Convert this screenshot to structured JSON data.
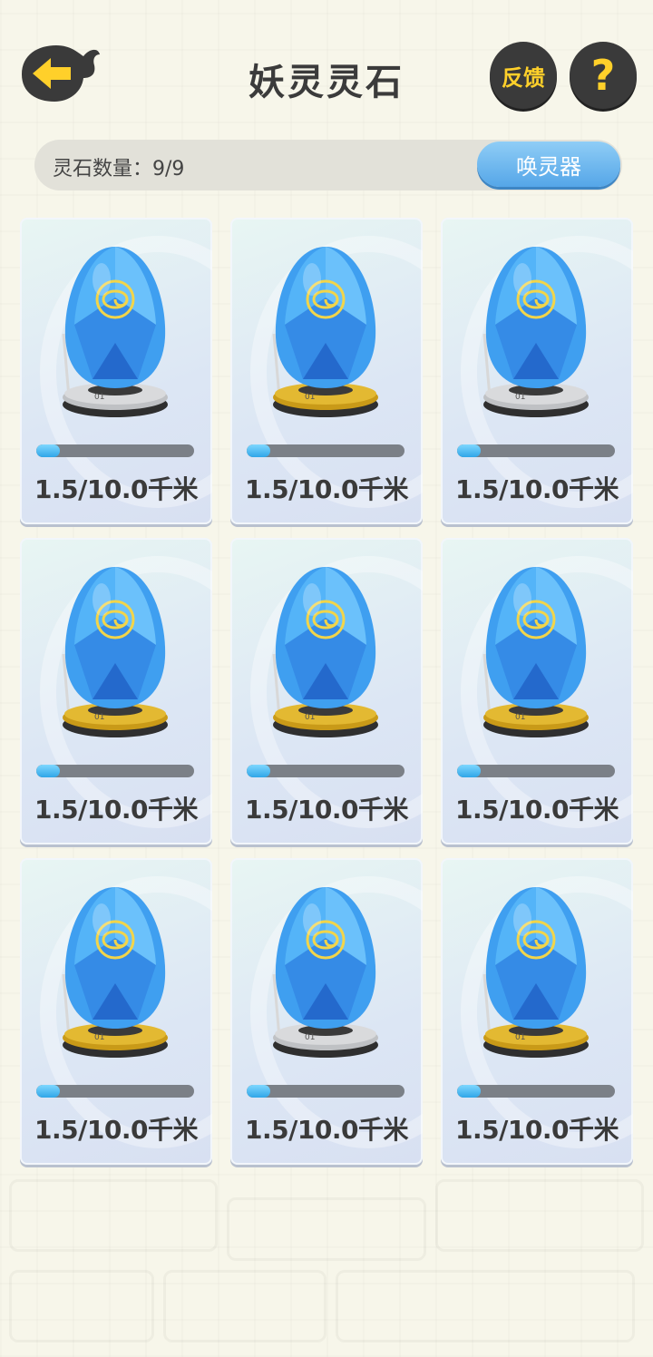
{
  "header": {
    "title": "妖灵灵石",
    "feedback_label": "反馈",
    "help_label": "?"
  },
  "count_bar": {
    "label": "灵石数量：9/9",
    "summon_label": "唤灵器"
  },
  "stones": [
    {
      "distance": "1.5/10.0千米",
      "progress": 0.15,
      "base": "silver"
    },
    {
      "distance": "1.5/10.0千米",
      "progress": 0.15,
      "base": "gold"
    },
    {
      "distance": "1.5/10.0千米",
      "progress": 0.15,
      "base": "silver"
    },
    {
      "distance": "1.5/10.0千米",
      "progress": 0.15,
      "base": "gold"
    },
    {
      "distance": "1.5/10.0千米",
      "progress": 0.15,
      "base": "gold"
    },
    {
      "distance": "1.5/10.0千米",
      "progress": 0.15,
      "base": "gold"
    },
    {
      "distance": "1.5/10.0千米",
      "progress": 0.15,
      "base": "gold"
    },
    {
      "distance": "1.5/10.0千米",
      "progress": 0.15,
      "base": "silver"
    },
    {
      "distance": "1.5/10.0千米",
      "progress": 0.15,
      "base": "gold"
    }
  ],
  "colors": {
    "accent": "#ffd02a",
    "button_dark": "#3a3a3a",
    "summon_blue": "#55a6e8",
    "progress_fill": "#2fa6e8"
  }
}
